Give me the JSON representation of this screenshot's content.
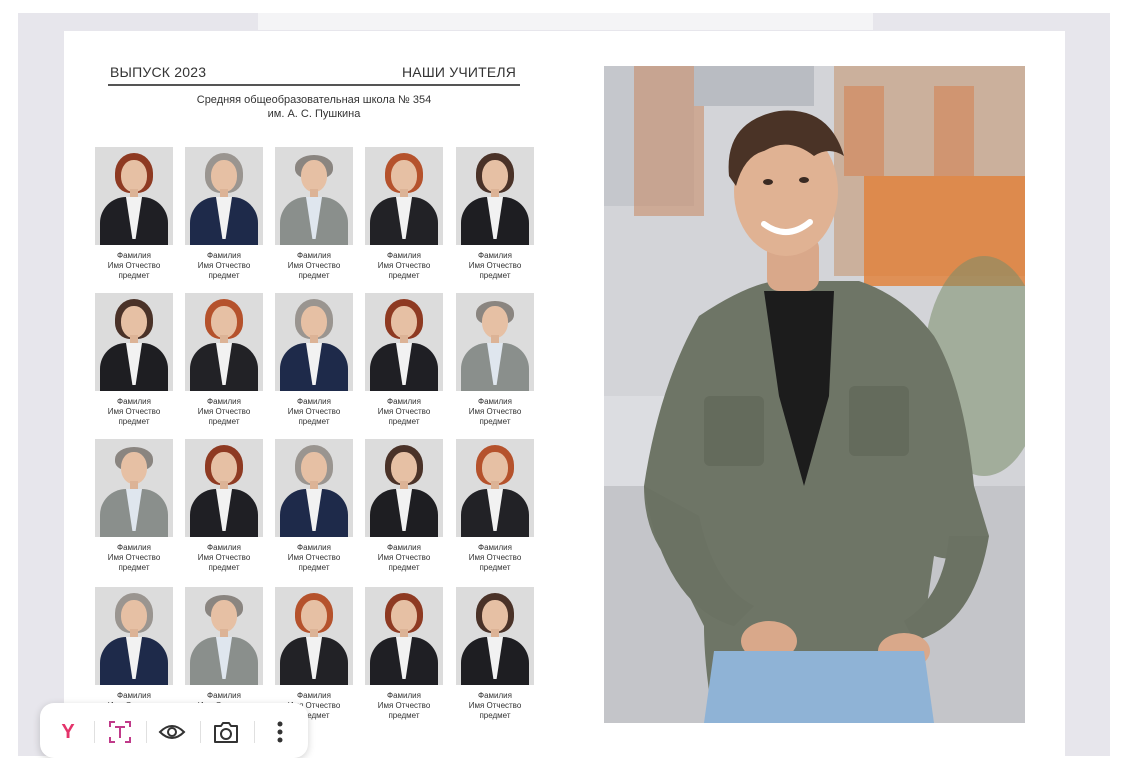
{
  "header": {
    "left": "ВЫПУСК 2023",
    "right": "НАШИ УЧИТЕЛЯ",
    "school_line1": "Средняя общеобразовательная школа № 354",
    "school_line2": "им. А. С. Пушкина"
  },
  "teachers": [
    {
      "name": "Фамилия",
      "patronymic": "Имя Отчество",
      "subject": "предмет",
      "look": "redhair"
    },
    {
      "name": "Фамилия",
      "patronymic": "Имя Отчество",
      "subject": "предмет",
      "look": "greyhair"
    },
    {
      "name": "Фамилия",
      "patronymic": "Имя Отчество",
      "subject": "предмет",
      "look": "man"
    },
    {
      "name": "Фамилия",
      "patronymic": "Имя Отчество",
      "subject": "предмет",
      "look": "redshort"
    },
    {
      "name": "Фамилия",
      "patronymic": "Имя Отчество",
      "subject": "предмет",
      "look": "brown"
    },
    {
      "name": "Фамилия",
      "patronymic": "Имя Отчество",
      "subject": "предмет",
      "look": "brown"
    },
    {
      "name": "Фамилия",
      "patronymic": "Имя Отчество",
      "subject": "предмет",
      "look": "redshort"
    },
    {
      "name": "Фамилия",
      "patronymic": "Имя Отчество",
      "subject": "предмет",
      "look": "greyhair"
    },
    {
      "name": "Фамилия",
      "patronymic": "Имя Отчество",
      "subject": "предмет",
      "look": "redhair"
    },
    {
      "name": "Фамилия",
      "patronymic": "Имя Отчество",
      "subject": "предмет",
      "look": "man"
    },
    {
      "name": "Фамилия",
      "patronymic": "Имя Отчество",
      "subject": "предмет",
      "look": "man"
    },
    {
      "name": "Фамилия",
      "patronymic": "Имя Отчество",
      "subject": "предмет",
      "look": "redhair"
    },
    {
      "name": "Фамилия",
      "patronymic": "Имя Отчество",
      "subject": "предмет",
      "look": "greyhair"
    },
    {
      "name": "Фамилия",
      "patronymic": "Имя Отчество",
      "subject": "предмет",
      "look": "brown"
    },
    {
      "name": "Фамилия",
      "patronymic": "Имя Отчество",
      "subject": "предмет",
      "look": "redshort"
    },
    {
      "name": "Фамилия",
      "patronymic": "Имя Отчество",
      "subject": "предмет",
      "look": "greyhair"
    },
    {
      "name": "Фамилия",
      "patronymic": "Имя Отчество",
      "subject": "предмет",
      "look": "man"
    },
    {
      "name": "Фамилия",
      "patronymic": "Имя Отчество",
      "subject": "предмет",
      "look": "redshort"
    },
    {
      "name": "Фамилия",
      "patronymic": "Имя Отчество",
      "subject": "предмет",
      "look": "redhair"
    },
    {
      "name": "Фамилия",
      "patronymic": "Имя Отчество",
      "subject": "предмет",
      "look": "brown"
    }
  ],
  "looks": {
    "redhair": {
      "hair": "#8e3a22",
      "body": "#1f1f24"
    },
    "redshort": {
      "hair": "#b5522c",
      "body": "#222226"
    },
    "greyhair": {
      "hair": "#9a9590",
      "body": "#1e2a4a"
    },
    "brown": {
      "hair": "#4a3228",
      "body": "#1e1e22"
    },
    "man": {
      "hair": "#8a8580",
      "body": "#8a8f8c"
    }
  },
  "toolbar": {
    "yandex_label": "Y",
    "items": [
      "yandex-logo-icon",
      "text-recognition-icon",
      "eye-icon",
      "camera-search-icon",
      "more-vertical-icon"
    ],
    "accent": "#e4336a"
  },
  "colors": {
    "frame": "#e7e6ec",
    "shirt": "#6e7566",
    "jeans": "#8fb3d6"
  }
}
